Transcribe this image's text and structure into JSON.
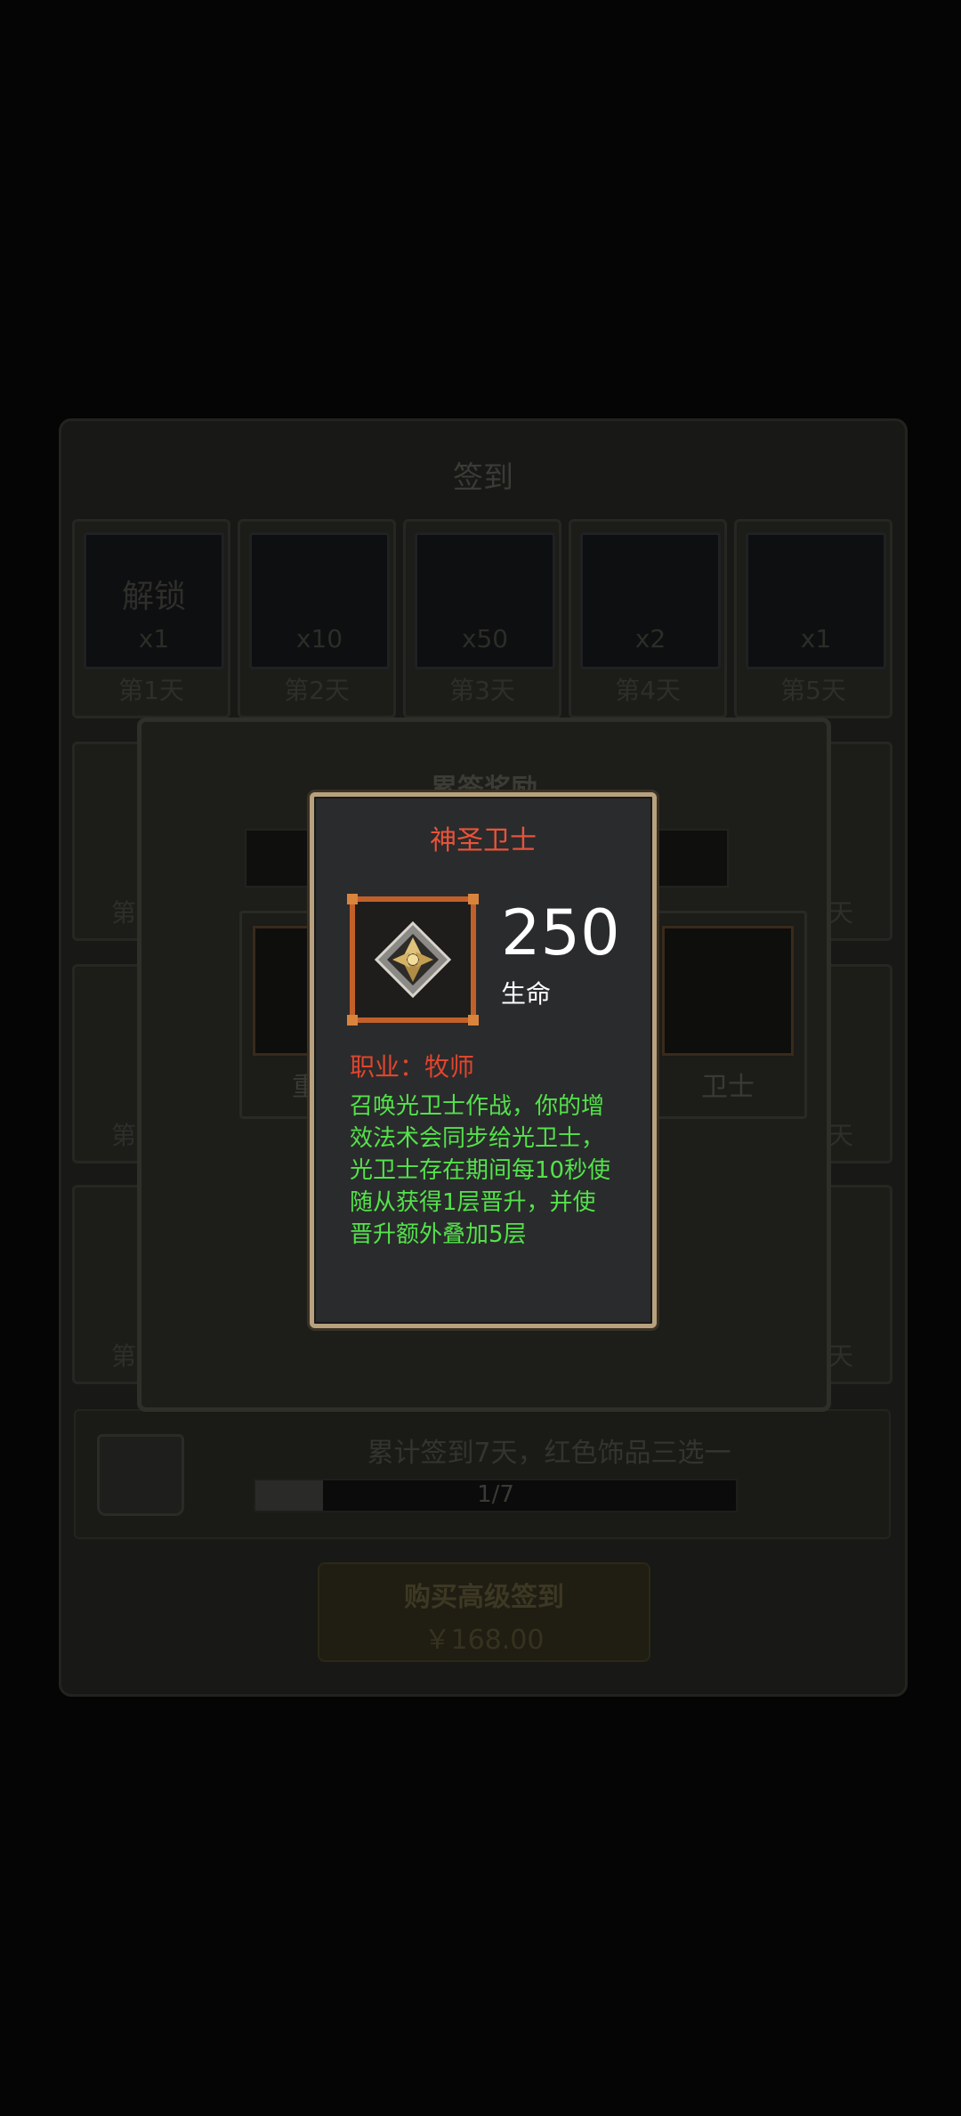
{
  "signin": {
    "title": "签到",
    "days": [
      {
        "icon": "解锁",
        "qty": "x1",
        "label": "第1天"
      },
      {
        "icon": "",
        "qty": "x10",
        "label": "第2天"
      },
      {
        "icon": "",
        "qty": "x50",
        "label": "第3天"
      },
      {
        "icon": "",
        "qty": "x2",
        "label": "第4天"
      },
      {
        "icon": "",
        "qty": "x1",
        "label": "第5天"
      }
    ],
    "side_labels_left": [
      "第",
      "第",
      "第"
    ],
    "side_labels_right": [
      "天",
      "天",
      "天"
    ],
    "cumulative_text": "累计签到7天，红色饰品三选一",
    "progress_text": "1/7",
    "progress_fraction": 0.14,
    "buy_label": "购买高级签到",
    "buy_price": "￥168.00"
  },
  "reward_panel": {
    "title": "累签奖励",
    "cards": [
      {
        "label": "重型"
      },
      {
        "label": "卫士"
      }
    ]
  },
  "detail": {
    "title": "神圣卫士",
    "stat_value": "250",
    "stat_label": "生命",
    "class_prefix": "职业：",
    "class_value": "牧师",
    "description_lines": [
      "召唤光卫士作战，你的增",
      "效法术会同步给光卫士，",
      "光卫士存在期间每10秒使",
      "随从获得1层晋升，并使",
      "晋升额外叠加5层"
    ],
    "item_icon": "holy-guardian-icon"
  },
  "colors": {
    "popup_border": "#b8a17e",
    "title_red": "#e8533a",
    "desc_green": "#53e24a",
    "frame_orange": "#c2602a"
  }
}
